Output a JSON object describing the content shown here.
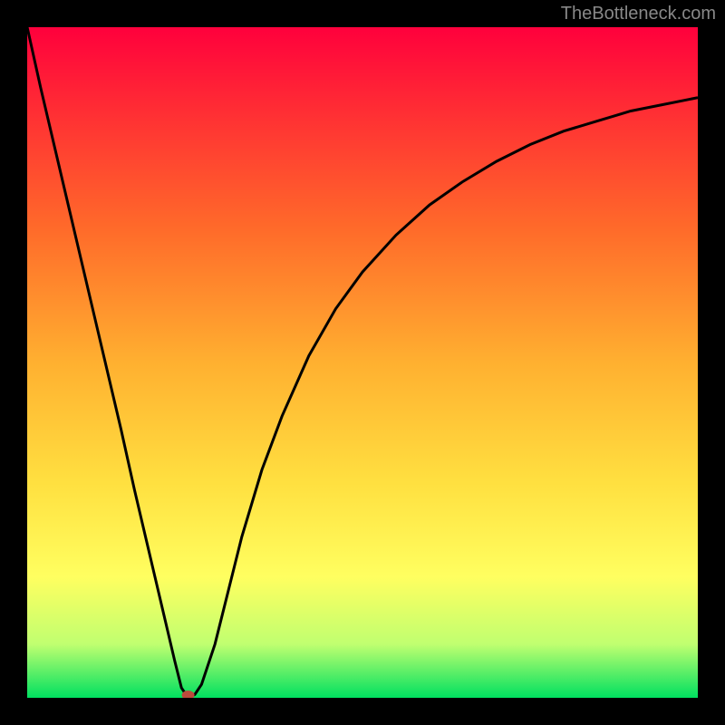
{
  "attribution": "TheBottleneck.com",
  "chart_data": {
    "type": "line",
    "title": "",
    "xlabel": "",
    "ylabel": "",
    "xlim": [
      0,
      100
    ],
    "ylim": [
      0,
      100
    ],
    "annotations": "Background gradient from red (top, high bottleneck) to green (bottom, zero bottleneck). Curve minimum marks optimal pairing.",
    "x": [
      0,
      2,
      4,
      6,
      8,
      10,
      12,
      14,
      16,
      18,
      20,
      22,
      23,
      24,
      25,
      26,
      28,
      30,
      32,
      35,
      38,
      42,
      46,
      50,
      55,
      60,
      65,
      70,
      75,
      80,
      85,
      90,
      95,
      100
    ],
    "values": [
      100,
      91,
      82.5,
      74,
      65.5,
      57,
      48.5,
      40,
      31,
      22.5,
      14,
      5.5,
      1.5,
      0,
      0.5,
      2,
      8,
      16,
      24,
      34,
      42,
      51,
      58,
      63.5,
      69,
      73.5,
      77,
      80,
      82.5,
      84.5,
      86,
      87.5,
      88.5,
      89.5
    ],
    "marker": {
      "x": 24,
      "y": 0
    },
    "gradient_stops": [
      {
        "offset": 0.0,
        "color": "#ff003c"
      },
      {
        "offset": 0.14,
        "color": "#ff3333"
      },
      {
        "offset": 0.3,
        "color": "#ff6a2a"
      },
      {
        "offset": 0.5,
        "color": "#ffb030"
      },
      {
        "offset": 0.68,
        "color": "#ffe040"
      },
      {
        "offset": 0.82,
        "color": "#ffff60"
      },
      {
        "offset": 0.92,
        "color": "#c0ff70"
      },
      {
        "offset": 1.0,
        "color": "#00e060"
      }
    ]
  }
}
